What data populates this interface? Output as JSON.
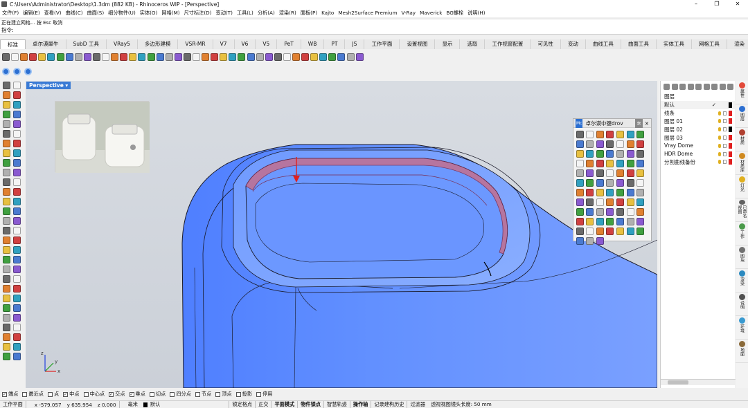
{
  "window": {
    "title": "C:\\Users\\Administrator\\Desktop\\1.3dm (882 KB) - Rhinoceros WIP - [Perspective]",
    "minimize_glyph": "–",
    "maximize_glyph": "❐",
    "close_glyph": "✕"
  },
  "menu": [
    "文件(F)",
    "编辑(E)",
    "查看(V)",
    "曲线(C)",
    "曲面(S)",
    "细分物件(U)",
    "实体(O)",
    "网格(M)",
    "尺寸标注(D)",
    "变动(T)",
    "工具(L)",
    "分析(A)",
    "渲染(R)",
    "面板(P)",
    "Kajto",
    "Mesh2Surface Premium",
    "V-Ray",
    "Maverick",
    "BG螺栓",
    "说明(H)"
  ],
  "command": {
    "history": "正在建立网格... 按 Esc 取消",
    "prompt": "指令:"
  },
  "tabs": [
    "标准",
    "卓尔谟犀牛",
    "SubD 工具",
    "VRay5",
    "多边形建模",
    "VSR-MR",
    "V7",
    "V6",
    "V5",
    "PeT",
    "WB",
    "PT",
    "JS",
    "工作平面",
    "设置视图",
    "显示",
    "选取",
    "工作视窗配置",
    "可见性",
    "变动",
    "曲线工具",
    "曲面工具",
    "实体工具",
    "网格工具",
    "渲染"
  ],
  "active_tab": "标准",
  "viewport": {
    "label": "Perspective",
    "label_arrow": "▾",
    "axis_x": "x",
    "axis_y": "y",
    "axis_z": "z"
  },
  "palette": {
    "badge": "Mc",
    "title": "卓尔谟中键drov",
    "gear_glyph": "✲",
    "close_glyph": "×"
  },
  "layers": {
    "header": "图层",
    "current_mark": "✓",
    "rows": [
      {
        "name": "默认",
        "color": "#000000",
        "current": true
      },
      {
        "name": "线条",
        "color": "#e02020"
      },
      {
        "name": "图层 01",
        "color": "#e02020"
      },
      {
        "name": "图层 02",
        "color": "#000000"
      },
      {
        "name": "图层 03",
        "color": "#e02020"
      },
      {
        "name": "Vray Dome",
        "color": "#e02020"
      },
      {
        "name": "HDR Dome",
        "color": "#e02020"
      },
      {
        "name": "分割曲线备份",
        "color": "#e02020"
      }
    ]
  },
  "right_tabs": [
    {
      "label": "属性",
      "color": "#e24a3a"
    },
    {
      "label": "图层",
      "color": "#2c6fd1"
    },
    {
      "label": "材质",
      "color": "#b04030"
    },
    {
      "label": "材质库",
      "color": "#d08a20"
    },
    {
      "label": "灯光",
      "color": "#e0b020"
    },
    {
      "label": "已命名视图",
      "color": "#606060"
    },
    {
      "label": "工作",
      "color": "#4a9a4a"
    },
    {
      "label": "图块",
      "color": "#707070"
    },
    {
      "label": "渲染",
      "color": "#2c8ac0"
    },
    {
      "label": "说明",
      "color": "#505050"
    },
    {
      "label": "环境",
      "color": "#3a9ad0"
    },
    {
      "label": "地面",
      "color": "#8a6a3a"
    }
  ],
  "osnap": [
    {
      "label": "端点",
      "checked": true
    },
    {
      "label": "最近点",
      "checked": false
    },
    {
      "label": "点",
      "checked": false
    },
    {
      "label": "中点",
      "checked": true
    },
    {
      "label": "中心点",
      "checked": false
    },
    {
      "label": "交点",
      "checked": true
    },
    {
      "label": "垂点",
      "checked": true
    },
    {
      "label": "切点",
      "checked": false
    },
    {
      "label": "四分点",
      "checked": false
    },
    {
      "label": "节点",
      "checked": false
    },
    {
      "label": "顶点",
      "checked": false
    },
    {
      "label": "投影",
      "checked": false
    },
    {
      "label": "停用",
      "checked": false
    }
  ],
  "status": {
    "cplane": "工作平面",
    "x": "x -579.057",
    "y": "y 635.954",
    "z": "z 0.000",
    "unit": "毫米",
    "layer": "默认",
    "toggles": [
      "锁定格点",
      "正交",
      "平面模式",
      "物件锁点",
      "智慧轨迹",
      "操作轴",
      "记录建构历史",
      "过滤器"
    ],
    "bold_toggles": [
      "平面模式",
      "物件锁点",
      "操作轴"
    ],
    "lens": "透视视图镜头长度: 50 mm"
  },
  "colors": {
    "model_fill": "#5f8eff",
    "model_edge": "#1a1a2a",
    "highlight_band": "#c4708f",
    "arrow": "#e02020",
    "axis_x": "#e02020",
    "axis_y": "#20a020",
    "axis_z": "#2040e0"
  }
}
